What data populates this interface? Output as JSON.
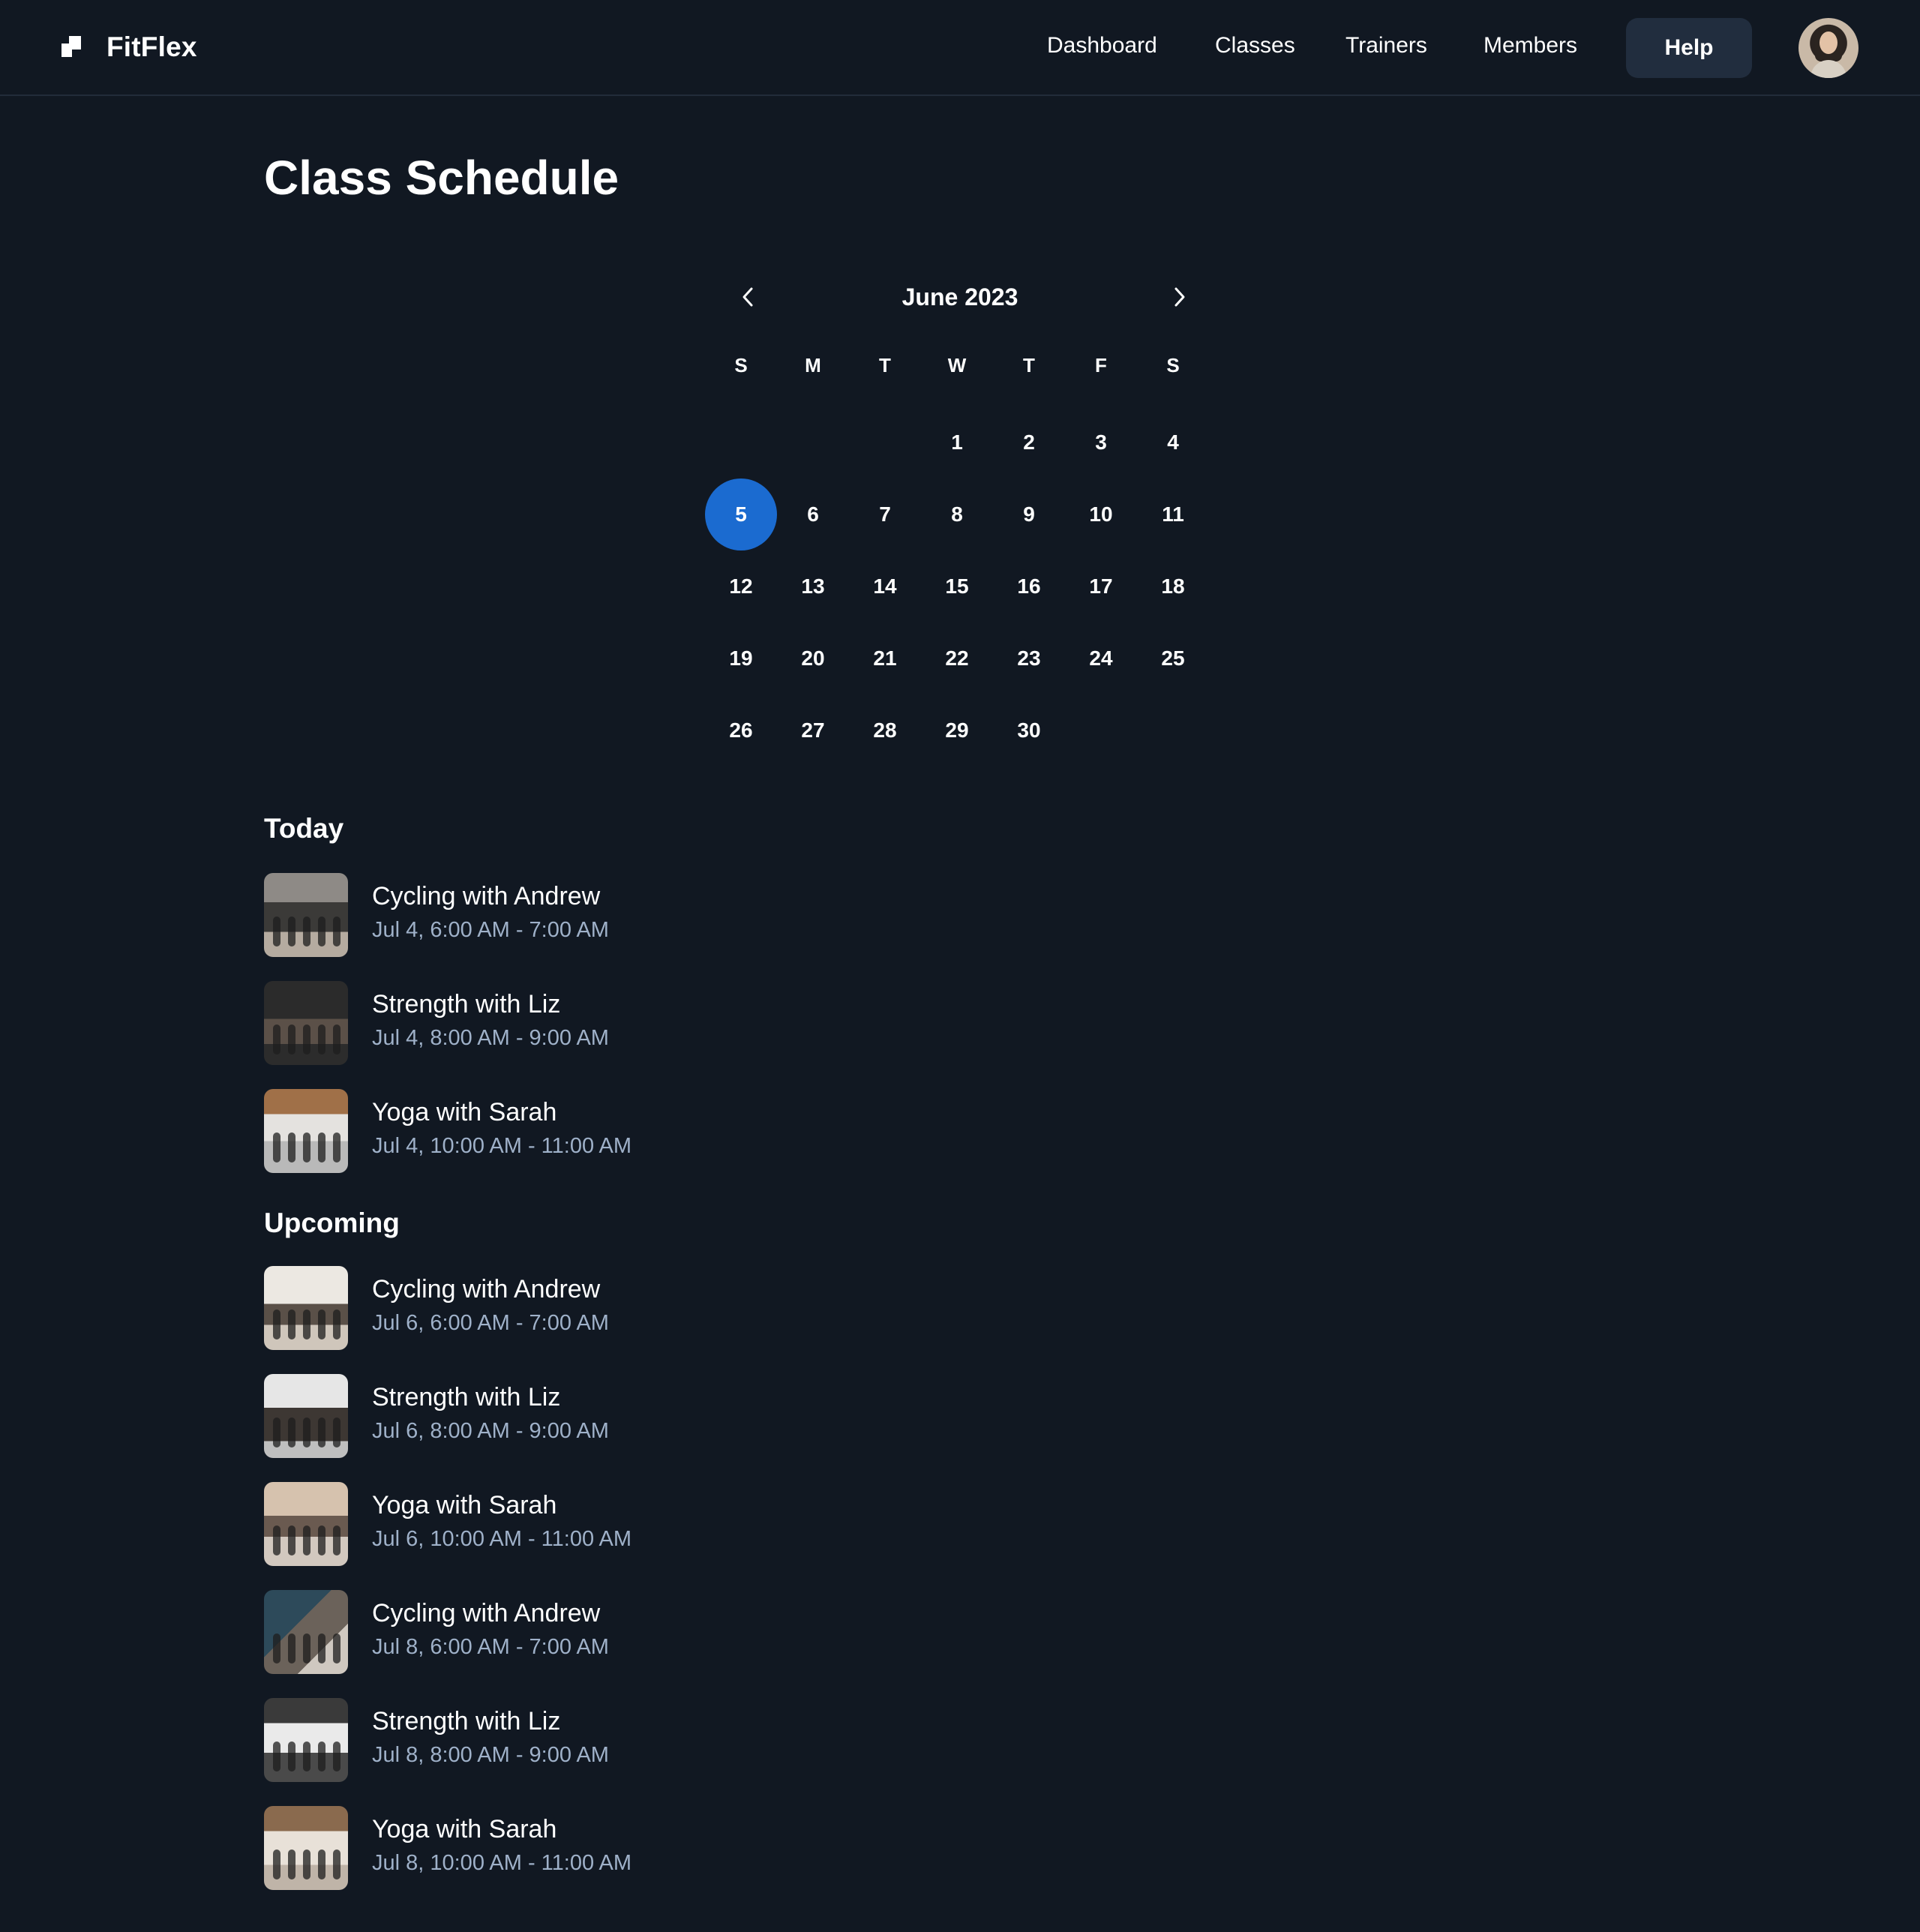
{
  "header": {
    "brand": "FitFlex",
    "nav": [
      "Dashboard",
      "Classes",
      "Trainers",
      "Members"
    ],
    "help_label": "Help"
  },
  "page_title": "Class Schedule",
  "calendar": {
    "month_label": "June 2023",
    "weekdays": [
      "S",
      "M",
      "T",
      "W",
      "T",
      "F",
      "S"
    ],
    "selected_day": "5",
    "weeks": [
      [
        "",
        "",
        "",
        "1",
        "2",
        "3",
        "4"
      ],
      [
        "5",
        "6",
        "7",
        "8",
        "9",
        "10",
        "11"
      ],
      [
        "12",
        "13",
        "14",
        "15",
        "16",
        "17",
        "18"
      ],
      [
        "19",
        "20",
        "21",
        "22",
        "23",
        "24",
        "25"
      ],
      [
        "26",
        "27",
        "28",
        "29",
        "30",
        "",
        ""
      ]
    ]
  },
  "today": {
    "title": "Today",
    "items": [
      {
        "title": "Cycling with Andrew",
        "time": "Jul 4, 6:00 AM - 7:00 AM"
      },
      {
        "title": "Strength with Liz",
        "time": "Jul 4, 8:00 AM - 9:00 AM"
      },
      {
        "title": "Yoga with Sarah",
        "time": "Jul 4, 10:00 AM - 11:00 AM"
      }
    ]
  },
  "upcoming": {
    "title": "Upcoming",
    "items": [
      {
        "title": "Cycling with Andrew",
        "time": "Jul 6, 6:00 AM - 7:00 AM"
      },
      {
        "title": "Strength with Liz",
        "time": "Jul 6, 8:00 AM - 9:00 AM"
      },
      {
        "title": "Yoga with Sarah",
        "time": "Jul 6, 10:00 AM - 11:00 AM"
      },
      {
        "title": "Cycling with Andrew",
        "time": "Jul 8, 6:00 AM - 7:00 AM"
      },
      {
        "title": "Strength with Liz",
        "time": "Jul 8, 8:00 AM - 9:00 AM"
      },
      {
        "title": "Yoga with Sarah",
        "time": "Jul 8, 10:00 AM - 11:00 AM"
      }
    ]
  },
  "colors": {
    "background": "#111822",
    "accent": "#1b6bd0",
    "help_button": "#212d3e",
    "muted_text": "#9fb1c9"
  }
}
